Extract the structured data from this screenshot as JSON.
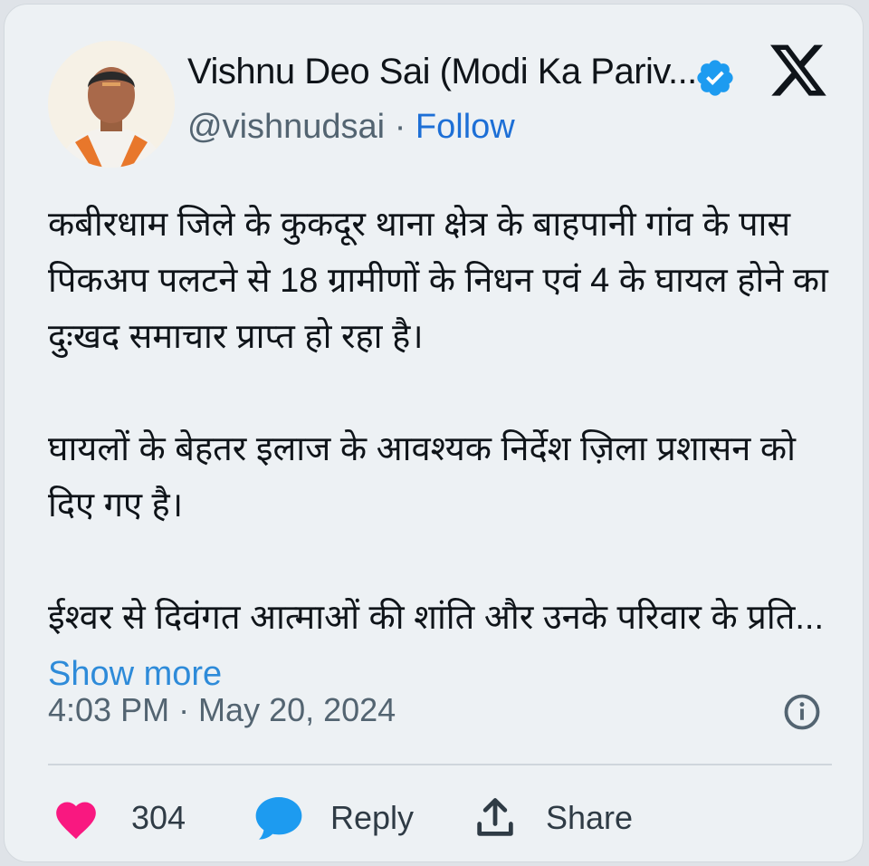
{
  "tweet": {
    "author": {
      "name": "Vishnu Deo Sai (Modi Ka Pariv...",
      "handle": "@vishnudsai",
      "separator": "·",
      "follow_label": "Follow",
      "verified_icon": "verified-badge-icon",
      "avatar": "profile-photo"
    },
    "platform_icon": "x-logo-icon",
    "paragraphs": [
      "कबीरधाम जिले के कुकदूर थाना क्षेत्र के बाहपानी गांव के पास पिकअप पलटने से 18 ग्रामीणों के निधन एवं 4 के घायल होने  का दुःखद समाचार प्राप्त हो रहा है।",
      "घायलों के बेहतर इलाज के आवश्यक निर्देश ज़िला प्रशासन को दिए गए है।",
      "ईश्वर से दिवंगत आत्माओं की शांति और उनके परिवार के प्रति..."
    ],
    "show_more_label": "Show more",
    "timestamp": "4:03 PM · May 20, 2024",
    "info_icon": "info-icon",
    "actions": {
      "likes_count": "304",
      "reply_label": "Reply",
      "share_label": "Share"
    }
  },
  "colors": {
    "background": "#edf1f4",
    "text": "#0f1419",
    "secondary": "#536471",
    "follow": "#1d6fd6",
    "show_more": "#2e8bd9",
    "verified": "#1d9bf0",
    "heart": "#f91880",
    "reply_bubble": "#1d9bf0"
  }
}
